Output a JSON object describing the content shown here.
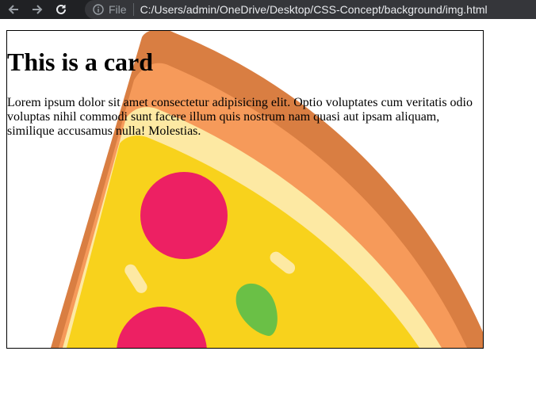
{
  "browser": {
    "back_icon": "arrow-left-icon",
    "forward_icon": "arrow-right-icon",
    "reload_icon": "reload-icon",
    "info_icon": "info-circle-icon",
    "scheme": "File",
    "url": "C:/Users/admin/OneDrive/Desktop/CSS-Concept/background/img.html"
  },
  "card": {
    "title": "This is a card",
    "text": "Lorem ipsum dolor sit amet consectetur adipisicing elit. Optio voluptates cum veritatis odio voluptas nihil commodi sunt facere illum quis nostrum nam quasi aut ipsam aliquam, similique accusamus nulla! Molestias.",
    "background_image": "pizza-slice",
    "colors": {
      "crust_dark": "#d97e42",
      "crust_light": "#f69a5a",
      "cheese_edge": "#fde9a3",
      "cheese": "#f8d21c",
      "pepperoni": "#ed2063",
      "basil": "#6ac046",
      "highlight": "#fde9a3"
    }
  }
}
